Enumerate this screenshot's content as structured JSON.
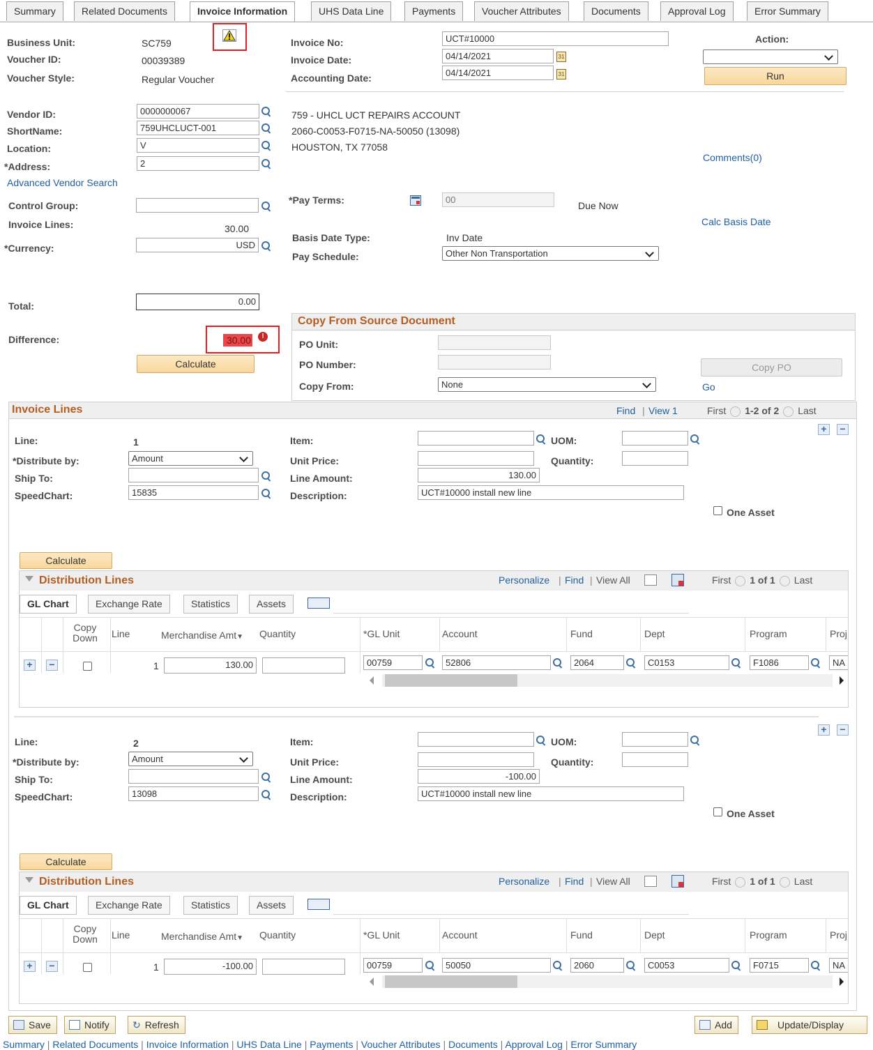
{
  "tabs": [
    "Summary",
    "Related Documents",
    "Invoice Information",
    "UHS Data Line",
    "Payments",
    "Voucher Attributes",
    "Documents",
    "Approval Log",
    "Error Summary"
  ],
  "header": {
    "business_unit_label": "Business Unit:",
    "business_unit": "SC759",
    "voucher_id_label": "Voucher ID:",
    "voucher_id": "00039389",
    "voucher_style_label": "Voucher Style:",
    "voucher_style": "Regular Voucher",
    "invoice_no_label": "Invoice No:",
    "invoice_no": "UCT#10000",
    "invoice_date_label": "Invoice Date:",
    "invoice_date": "04/14/2021",
    "accounting_date_label": "Accounting Date:",
    "accounting_date": "04/14/2021",
    "action_label": "Action:",
    "action_value": "",
    "run_label": "Run"
  },
  "vendor": {
    "vendor_id_label": "Vendor ID:",
    "vendor_id": "0000000067",
    "shortname_label": "ShortName:",
    "shortname": "759UHCLUCT-001",
    "location_label": "Location:",
    "location": "V",
    "address_label": "*Address:",
    "address": "2",
    "advanced_search": "Advanced Vendor Search",
    "name_line1": "759 - UHCL UCT REPAIRS ACCOUNT",
    "name_line2": "2060-C0053-F0715-NA-50050 (13098)",
    "name_line3": "HOUSTON, TX  77058",
    "comments": "Comments(0)"
  },
  "amounts": {
    "control_group_label": "Control Group:",
    "control_group": "",
    "invoice_lines_label": "Invoice Lines:",
    "invoice_lines": "30.00",
    "currency_label": "*Currency:",
    "currency": "USD",
    "pay_terms_label": "*Pay Terms:",
    "pay_terms": "00",
    "pay_terms_desc": "Due Now",
    "calc_basis_date": "Calc Basis Date",
    "basis_date_type_label": "Basis Date Type:",
    "basis_date_type": "Inv Date",
    "pay_schedule_label": "Pay Schedule:",
    "pay_schedule": "Other Non Transportation",
    "total_label": "Total:",
    "total": "0.00",
    "difference_label": "Difference:",
    "difference": "30.00",
    "calculate_label": "Calculate"
  },
  "copy_from": {
    "title": "Copy From Source Document",
    "po_unit_label": "PO Unit:",
    "po_unit": "",
    "po_number_label": "PO Number:",
    "po_number": "",
    "copy_from_label": "Copy From:",
    "copy_from": "None",
    "copy_po_label": "Copy PO",
    "go_label": "Go"
  },
  "invoice_lines_section": {
    "title": "Invoice Lines",
    "find": "Find",
    "view": "View 1",
    "first": "First",
    "range": "1-2 of 2",
    "last": "Last"
  },
  "line_labels": {
    "line": "Line:",
    "distribute_by": "*Distribute by:",
    "ship_to": "Ship To:",
    "speedchart": "SpeedChart:",
    "item": "Item:",
    "uom": "UOM:",
    "unit_price": "Unit Price:",
    "quantity": "Quantity:",
    "line_amount": "Line Amount:",
    "description": "Description:",
    "one_asset": "One Asset",
    "calculate": "Calculate"
  },
  "dist_labels": {
    "title": "Distribution Lines",
    "personalize": "Personalize",
    "find": "Find",
    "view_all": "View All",
    "first": "First",
    "range": "1 of 1",
    "last": "Last",
    "tabs": [
      "GL Chart",
      "Exchange Rate",
      "Statistics",
      "Assets"
    ],
    "cols": {
      "copy_down": "Copy Down",
      "line": "Line",
      "merch_amt": "Merchandise Amt",
      "quantity": "Quantity",
      "gl_unit": "*GL Unit",
      "account": "Account",
      "fund": "Fund",
      "dept": "Dept",
      "program": "Program",
      "proj": "Proj"
    }
  },
  "lines": [
    {
      "line": "1",
      "distribute_by": "Amount",
      "ship_to": "",
      "speedchart": "15835",
      "item": "",
      "uom": "",
      "unit_price": "",
      "quantity": "",
      "line_amount": "130.00",
      "description": "UCT#10000 install new line",
      "dist": {
        "line": "1",
        "merch_amt": "130.00",
        "quantity": "",
        "gl_unit": "00759",
        "account": "52806",
        "fund": "2064",
        "dept": "C0153",
        "program": "F1086",
        "proj": "NA"
      }
    },
    {
      "line": "2",
      "distribute_by": "Amount",
      "ship_to": "",
      "speedchart": "13098",
      "item": "",
      "uom": "",
      "unit_price": "",
      "quantity": "",
      "line_amount": "-100.00",
      "description": "UCT#10000 install new line",
      "dist": {
        "line": "1",
        "merch_amt": "-100.00",
        "quantity": "",
        "gl_unit": "00759",
        "account": "50050",
        "fund": "2060",
        "dept": "C0053",
        "program": "F0715",
        "proj": "NA"
      }
    }
  ],
  "toolbar": {
    "save": "Save",
    "notify": "Notify",
    "refresh": "Refresh",
    "add": "Add",
    "update_display": "Update/Display"
  },
  "footer_links": [
    "Summary",
    "Related Documents",
    "Invoice Information",
    "UHS Data Line",
    "Payments",
    "Voucher Attributes",
    "Documents",
    "Approval Log",
    "Error Summary"
  ],
  "colors": {
    "accent": "#b45d22",
    "link": "#1f5f9f",
    "error_bg": "#e8474c",
    "highlight_box": "#e02020"
  }
}
